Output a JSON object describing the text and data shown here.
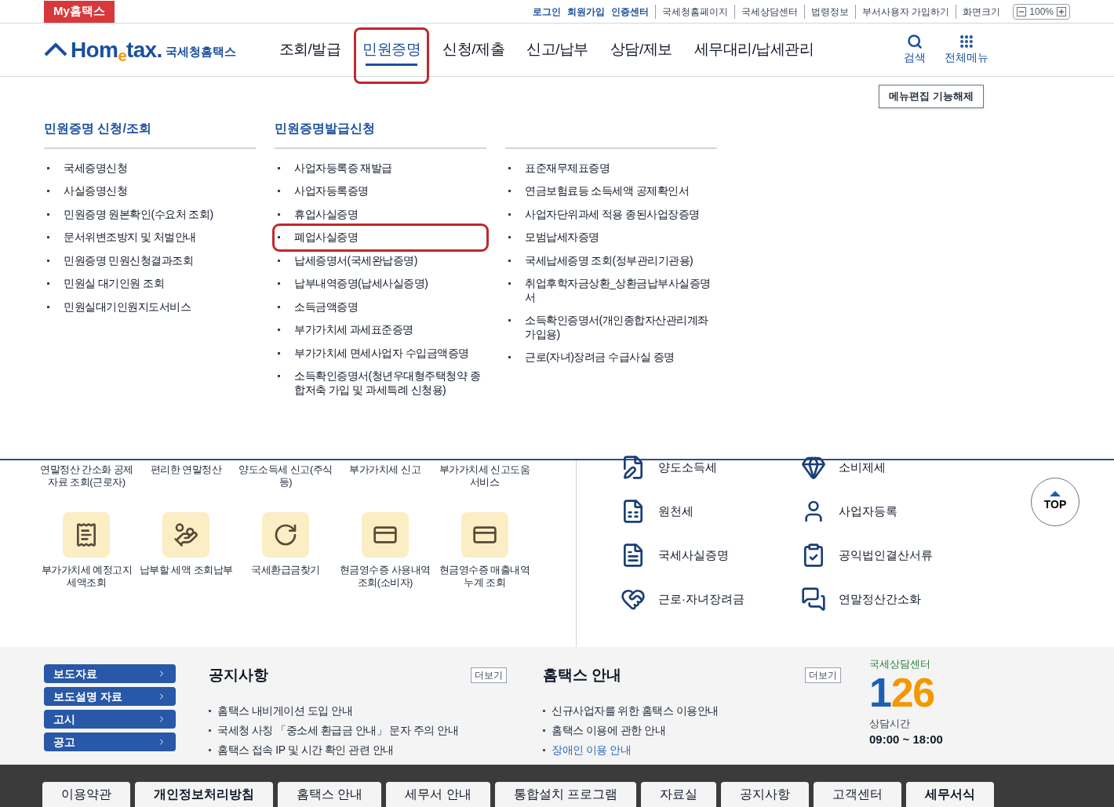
{
  "top_bar": {
    "my_link": "My홈택스",
    "account_links": [
      "로그인",
      "회원가입",
      "인증센터"
    ],
    "site_links": [
      "국세청홈페이지",
      "국세상담센터",
      "법령정보",
      "부서사용자 가입하기"
    ],
    "zoom_label": "화면크기",
    "zoom_value": "100%"
  },
  "header": {
    "logo": {
      "wordmark": "Hom$_{e}$tax.",
      "name": "국세청홈택스"
    },
    "nav": [
      {
        "label": "조회/발급",
        "selected": false,
        "highlighted": false
      },
      {
        "label": "민원증명",
        "selected": true,
        "highlighted": true
      },
      {
        "label": "신청/제출",
        "selected": false,
        "highlighted": false
      },
      {
        "label": "신고/납부",
        "selected": false,
        "highlighted": false
      },
      {
        "label": "상담/제보",
        "selected": false,
        "highlighted": false
      },
      {
        "label": "세무대리/납세관리",
        "selected": false,
        "highlighted": false
      }
    ],
    "search": "검색",
    "all_menu": "전체메뉴"
  },
  "mega_menu": {
    "edit_button": "메뉴편집 기능해제",
    "columns": [
      {
        "heading": "민원증명 신청/조회",
        "items": [
          {
            "label": "국세증명신청",
            "highlighted": false
          },
          {
            "label": "사실증명신청",
            "highlighted": false
          },
          {
            "label": "민원증명 원본확인(수요처 조회)",
            "highlighted": false
          },
          {
            "label": "문서위변조방지 및 처벌안내",
            "highlighted": false
          },
          {
            "label": "민원증명 민원신청결과조회",
            "highlighted": false
          },
          {
            "label": "민원실 대기인원 조회",
            "highlighted": false
          },
          {
            "label": "민원실대기인원지도서비스",
            "highlighted": false
          }
        ]
      },
      {
        "heading": "민원증명발급신청",
        "items": [
          {
            "label": "사업자등록증 재발급",
            "highlighted": false
          },
          {
            "label": "사업자등록증명",
            "highlighted": false
          },
          {
            "label": "휴업사실증명",
            "highlighted": false
          },
          {
            "label": "폐업사실증명",
            "highlighted": true
          },
          {
            "label": "납세증명서(국세완납증명)",
            "highlighted": false
          },
          {
            "label": "납부내역증명(납세사실증명)",
            "highlighted": false
          },
          {
            "label": "소득금액증명",
            "highlighted": false
          },
          {
            "label": "부가가치세 과세표준증명",
            "highlighted": false
          },
          {
            "label": "부가가치세 면세사업자 수입금액증명",
            "highlighted": false
          },
          {
            "label": "소득확인증명서(청년우대형주택청약 종합저축 가입 및 과세특례 신청용)",
            "highlighted": false
          }
        ]
      },
      {
        "items": [
          {
            "label": "표준재무제표증명",
            "highlighted": false
          },
          {
            "label": "연금보험료등 소득세액 공제확인서",
            "highlighted": false
          },
          {
            "label": "사업자단위과세 적용 종된사업장증명",
            "highlighted": false
          },
          {
            "label": "모범납세자증명",
            "highlighted": false
          },
          {
            "label": "국세납세증명 조회(정부관리기관용)",
            "highlighted": false
          },
          {
            "label": "취업후학자금상환_상환금납부사실증명서",
            "highlighted": false
          },
          {
            "label": "소득확인증명서(개인종합자산관리계좌 가입용)",
            "highlighted": false
          },
          {
            "label": "근로(자녀)장려금 수급사실 증명",
            "highlighted": false
          }
        ]
      }
    ]
  },
  "quick_services": [
    {
      "label": "연말정산 간소화 공제자료 조회(근로자)",
      "kind": "label"
    },
    {
      "label": "편리한 연말정산",
      "kind": "label"
    },
    {
      "label": "양도소득세 신고(주식등)",
      "kind": "label"
    },
    {
      "label": "부가가치세 신고",
      "kind": "label"
    },
    {
      "label": "부가가치세 신고도움 서비스",
      "kind": "label"
    },
    {
      "label": "부가가치세 예정고지 세액조회",
      "kind": "tile"
    },
    {
      "label": "납부할 세액 조회납부",
      "kind": "tile"
    },
    {
      "label": "국세환급금찾기",
      "kind": "tile"
    },
    {
      "label": "현금영수증 사용내역조회(소비자)",
      "kind": "tile"
    },
    {
      "label": "현금영수증 매출내역누계 조회",
      "kind": "tile"
    }
  ],
  "tax_links": [
    "양도소득세",
    "소비제세",
    "원천세",
    "사업자등록",
    "국세사실증명",
    "공익법인결산서류",
    "근로·자녀장려금",
    "연말정산간소화"
  ],
  "top_button": "TOP",
  "notice_buttons": [
    "보도자료",
    "보도설명 자료",
    "고시",
    "공고"
  ],
  "boards": [
    {
      "title": "공지사항",
      "more": "더보기",
      "items": [
        {
          "text": "홈택스 내비게이션 도입 안내",
          "link": false
        },
        {
          "text": "국세청 사칭 「중소세 환급금 안내」 문자 주의 안내",
          "link": false
        },
        {
          "text": "홈택스 접속 IP 및 시간 확인 관련 안내",
          "link": false
        }
      ]
    },
    {
      "title": "홈택스 안내",
      "more": "더보기",
      "items": [
        {
          "text": "신규사업자를 위한 홈택스 이용안내",
          "link": false
        },
        {
          "text": "홈택스 이용에 관한 안내",
          "link": false
        },
        {
          "text": "장애인 이용 안내",
          "link": true
        }
      ]
    }
  ],
  "call_center": {
    "title": "국세상담센터",
    "number": "126",
    "hours_label": "상담시간",
    "hours": "09:00 ~ 18:00"
  },
  "footer": [
    {
      "label": "이용약관",
      "emphasized": false
    },
    {
      "label": "개인정보처리방침",
      "emphasized": true
    },
    {
      "label": "홈택스 안내",
      "emphasized": false
    },
    {
      "label": "세무서 안내",
      "emphasized": false
    },
    {
      "label": "통합설치 프로그램",
      "emphasized": false
    },
    {
      "label": "자료실",
      "emphasized": false
    },
    {
      "label": "공지사항",
      "emphasized": false
    },
    {
      "label": "고객센터",
      "emphasized": false
    },
    {
      "label": "세무서식",
      "emphasized": true
    }
  ]
}
